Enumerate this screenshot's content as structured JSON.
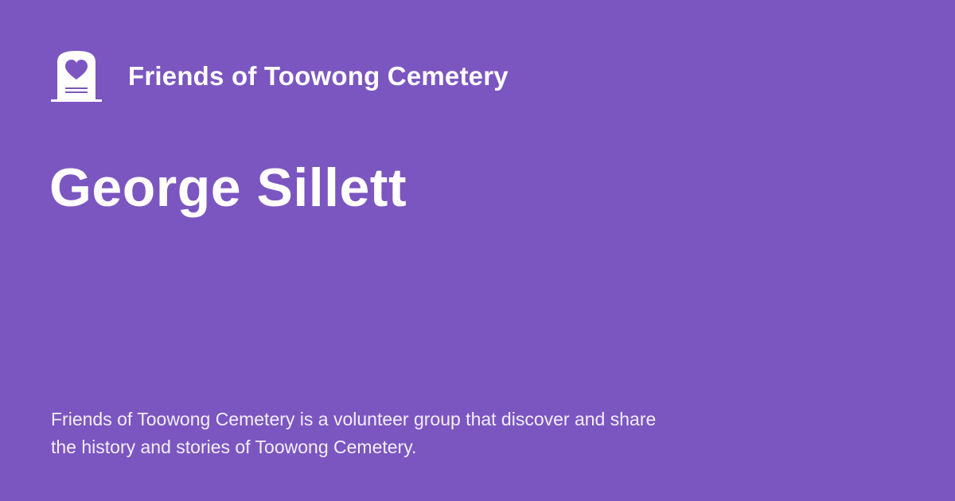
{
  "header": {
    "logo_icon": "headstone-heart-icon",
    "site_name": "Friends of Toowong Cemetery"
  },
  "main": {
    "title": "George Sillett"
  },
  "footer": {
    "description": "Friends of Toowong Cemetery is a volunteer group that discover and share the history and stories of Toowong Cemetery."
  },
  "colors": {
    "background": "#7b56c0",
    "text": "#ffffff",
    "icon_detail": "#7b56c0"
  }
}
